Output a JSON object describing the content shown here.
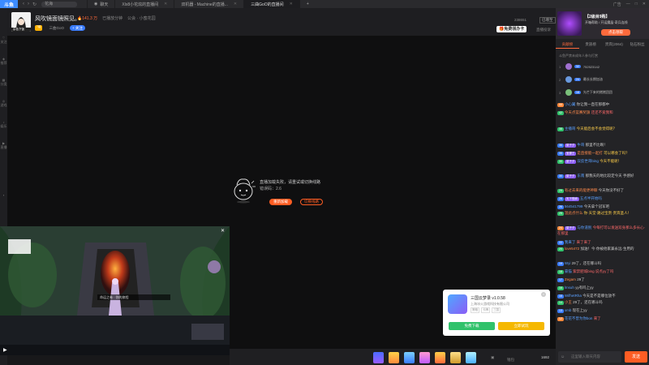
{
  "topbar": {
    "logo": "斗鱼",
    "search_placeholder": "花海",
    "tabs": [
      {
        "label": "聊天",
        "active": false
      },
      {
        "label": "Xlx8小花炫的直播间",
        "active": false
      },
      {
        "label": "双机器 - Machine的直播...",
        "active": false
      },
      {
        "label": "三曲GoO的直播间",
        "active": true
      }
    ],
    "winctl": [
      "广告",
      "—",
      "□",
      "✕"
    ]
  },
  "leftrail": [
    "关注",
    "推荐",
    "分类",
    "游戏",
    "娱乐",
    "直播"
  ],
  "header": {
    "avatar_label": "杂色下饭",
    "title": "风吹镜面镜照见。",
    "hot": "141.3 万",
    "meta": [
      "已播放分钟",
      "公会 · 小蜜花园"
    ],
    "level_badge": "7级",
    "streamer": "三曲GoO",
    "follow": "+ 关注",
    "room_id": "238651",
    "quality": "已增至",
    "free_gift": "免费领办卡",
    "report": "直播投诉"
  },
  "player": {
    "error_text": "直播加载失败，请重试或切换线路",
    "error_code": "错误码：2.6",
    "retry": "重新加载",
    "switch": "切换线路"
  },
  "pip": {
    "caption": "命运之卷 · 你的旅程"
  },
  "giftbar": {
    "labels": [
      "钱包",
      "1692"
    ]
  },
  "promo": {
    "title": "三国云梦录 v1.0.58",
    "sub": "上海冰火游戏科技有限公司",
    "tags": [
      "策略",
      "卡牌",
      "三国"
    ],
    "btn_download": "免费下载",
    "btn_play": "立即试玩",
    "close": "×"
  },
  "right": {
    "banner_title": "【2级目9购】",
    "banner_sub": "开箱帮助 / 开运魔晶·奇兵连线",
    "banner_btn": "点击领取",
    "tabs": [
      "贡献榜",
      "贵族榜",
      "贵宾(2064)",
      "钻石粉丝"
    ],
    "rank_note": "斗鱼严禁未成年人参与打赏",
    "ranks": [
      {
        "num": "1",
        "name": "752523142",
        "lv": "32"
      },
      {
        "num": "2",
        "name": "最长长期加油",
        "lv": "24"
      },
      {
        "num": "3",
        "name": "光芒下来的猪猪团团",
        "lv": "18"
      }
    ]
  },
  "chat": [
    {
      "lv": "44",
      "lvc": "#ff8a3c",
      "fans": "",
      "name": "小心翼",
      "text": "你让我一直在那都中",
      "tc": ""
    },
    {
      "lv": "42",
      "lvc": "#31c26b",
      "fans": "",
      "name": "今天点篮赛奖旗",
      "text": "还还不爱我和",
      "tc": "r",
      "no": true
    },
    {
      "lv": "38",
      "lvc": "#31c26b",
      "fans": "",
      "name": "主播哥",
      "text": "今天能后会不会觉得呢？",
      "tc": "y"
    },
    {
      "lv": "36",
      "lvc": "#3a7cff",
      "fans": "菜子夕",
      "name": "牛哥",
      "text": "那里不比啊！",
      "tc": ""
    },
    {
      "lv": "35",
      "lvc": "#3a7cff",
      "fans": "宝镖王",
      "name": "是直接能一起打",
      "text": "可以哪会了吗？",
      "tc": "y"
    },
    {
      "lv": "30",
      "lvc": "#31c26b",
      "fans": "菜子夕",
      "name": "双反世哥bing",
      "text": "今天不能呢！",
      "tc": "y"
    },
    {
      "lv": "30",
      "lvc": "#3a7cff",
      "fans": "菜子夕",
      "name": "东南",
      "text": "那我天的地比较定今天 手感好",
      "tc": ""
    },
    {
      "lv": "29",
      "lvc": "#31c26b",
      "fans": "",
      "name": "有过去来的能更神聊",
      "text": "今天你没不好了",
      "tc": ""
    },
    {
      "lv": "28",
      "lvc": "#3a7cff",
      "fans": "天下登麻",
      "name": "五点半开始吗",
      "text": "",
      "tc": "r"
    },
    {
      "lv": "26",
      "lvc": "#3a7cff",
      "fans": "",
      "name": "564541799",
      "text": "今天拿个冠军吧",
      "tc": ""
    },
    {
      "lv": "25",
      "lvc": "#31c26b",
      "fans": "",
      "name": "温此点什么",
      "text": "你·天堂·路过宝贵·贵宾圣人！",
      "tc": "y"
    },
    {
      "lv": "24",
      "lvc": "#ff8a3c",
      "fans": "菜子夕",
      "name": "与你道别",
      "text": "今每打可以发送双身那么多长心·在那里",
      "tc": "r"
    },
    {
      "lv": "22",
      "lvc": "#3a7cff",
      "fans": "",
      "name": "我来了",
      "text": "来了来了",
      "tc": "r"
    },
    {
      "lv": "20",
      "lvc": "#31c26b",
      "fans": "",
      "name": "love5472",
      "text": "加油！今·你被他家兼永远·生用的",
      "tc": ""
    },
    {
      "lv": "19",
      "lvc": "#3a7cff",
      "fans": "",
      "name": "Wyi",
      "text": "29了，还在哪斗吗",
      "tc": ""
    },
    {
      "lv": "18",
      "lvc": "#31c26b",
      "fans": "",
      "name": "豪猫",
      "text": "紫禁肥城bing 说点yy了吗",
      "tc": "r"
    },
    {
      "lv": "17",
      "lvc": "#3a7cff",
      "fans": "",
      "name": "Zegam",
      "text": "29了",
      "tc": ""
    },
    {
      "lv": "16",
      "lvc": "#31c26b",
      "fans": "",
      "name": "lmsuh",
      "text": "yy有吗上yy",
      "tc": ""
    },
    {
      "lv": "15",
      "lvc": "#3a7cff",
      "fans": "",
      "name": "WifhetRha",
      "text": "今天是不是哪位放不",
      "tc": ""
    },
    {
      "lv": "14",
      "lvc": "#31c26b",
      "fans": "",
      "name": "小王",
      "text": "29了，还在哪斗吗",
      "tc": ""
    },
    {
      "lv": "13",
      "lvc": "#3a7cff",
      "fans": "",
      "name": "xmb",
      "text": "现在上yy",
      "tc": ""
    },
    {
      "lv": "12",
      "lvc": "#ff8a3c",
      "fans": "",
      "name": "花花不曾为你bon",
      "text": "来了",
      "tc": "r"
    }
  ],
  "chat_input": {
    "placeholder": "这里输入聊天内容",
    "send": "发送"
  }
}
